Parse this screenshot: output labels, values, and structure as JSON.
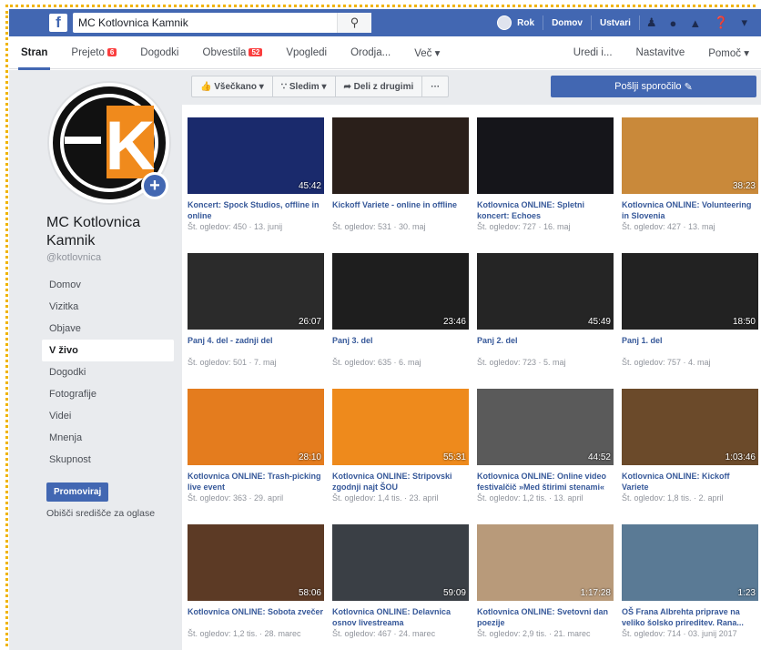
{
  "topbar": {
    "search_value": "MC Kotlovnica Kamnik",
    "user": "Rok",
    "home": "Domov",
    "create": "Ustvari",
    "brand_color": "#4267b2"
  },
  "subnav": {
    "tabs": [
      {
        "label": "Stran",
        "badge": ""
      },
      {
        "label": "Prejeto",
        "badge": "6"
      },
      {
        "label": "Dogodki",
        "badge": ""
      },
      {
        "label": "Obvestila",
        "badge": "52"
      },
      {
        "label": "Vpogledi",
        "badge": ""
      },
      {
        "label": "Orodja...",
        "badge": ""
      },
      {
        "label": "Več ▾",
        "badge": ""
      }
    ],
    "right": [
      "Uredi i...",
      "Nastavitve",
      "Pomoč ▾"
    ]
  },
  "page": {
    "logo_letter": "K",
    "name": "MC Kotlovnica Kamnik",
    "handle": "@kotlovnica",
    "nav": [
      "Domov",
      "Vizitka",
      "Objave",
      "V živo",
      "Dogodki",
      "Fotografije",
      "Videi",
      "Mnenja",
      "Skupnost"
    ],
    "selected_nav": "V živo",
    "promote": "Promoviraj",
    "ads_center": "Obišči središče za oglase"
  },
  "toolbar": {
    "all": "Vše­čkano",
    "follow": "Sledim",
    "share": "Deli z drugimi",
    "more": "···",
    "send_message": "Pošlji sporočilo"
  },
  "videos": [
    {
      "title": "Koncert: Spock Studios, offline in online",
      "meta": "Št. ogledov: 450 · 13. junij",
      "duration": "45:42",
      "thumb": "#1a2a6c"
    },
    {
      "title": "Kickoff Variete - online in offline",
      "meta": "Št. ogledov: 531 · 30. maj",
      "duration": "",
      "thumb": "#2a1f1a"
    },
    {
      "title": "Kotlovnica ONLINE: Spletni koncert: Echoes",
      "meta": "Št. ogledov: 727 · 16. maj",
      "duration": "",
      "thumb": "#15151a"
    },
    {
      "title": "Kotlovnica ONLINE: Volunteering in Slovenia",
      "meta": "Št. ogledov: 427 · 13. maj",
      "duration": "38:23",
      "thumb": "#c9893a"
    },
    {
      "title": "Panj 4. del - zadnji del",
      "meta": "Št. ogledov: 501 · 7. maj",
      "duration": "26:07",
      "thumb": "#2b2b2b"
    },
    {
      "title": "Panj 3. del",
      "meta": "Št. ogledov: 635 · 6. maj",
      "duration": "23:46",
      "thumb": "#1e1e1e"
    },
    {
      "title": "Panj 2. del",
      "meta": "Št. ogledov: 723 · 5. maj",
      "duration": "45:49",
      "thumb": "#252525"
    },
    {
      "title": "Panj 1. del",
      "meta": "Št. ogledov: 757 · 4. maj",
      "duration": "18:50",
      "thumb": "#222222"
    },
    {
      "title": "Kotlovnica ONLINE: Trash-picking live event",
      "meta": "Št. ogledov: 363 · 29. april",
      "duration": "28:10",
      "thumb": "#e47c1e"
    },
    {
      "title": "Kotlovnica ONLINE: Stripovski zgodnji najt ŠOU",
      "meta": "Št. ogledov: 1,4 tis. · 23. april",
      "duration": "55:31",
      "thumb": "#ee8a1c"
    },
    {
      "title": "Kotlovnica ONLINE: Online video festivalčič »Med štirimi stenami«",
      "meta": "Št. ogledov: 1,2 tis. · 13. april",
      "duration": "44:52",
      "thumb": "#5a5a5a"
    },
    {
      "title": "Kotlovnica ONLINE: Kickoff Variete",
      "meta": "Št. ogledov: 1,8 tis. · 2. april",
      "duration": "1:03:46",
      "thumb": "#6b4a2a"
    },
    {
      "title": "Kotlovnica ONLINE: Sobota zvečer",
      "meta": "Št. ogledov: 1,2 tis. · 28. marec",
      "duration": "58:06",
      "thumb": "#5c3a25"
    },
    {
      "title": "Kotlovnica ONLINE: Delavnica osnov livestreama",
      "meta": "Št. ogledov: 467 · 24. marec",
      "duration": "59:09",
      "thumb": "#3a3f45"
    },
    {
      "title": "Kotlovnica ONLINE: Svetovni dan poezije",
      "meta": "Št. ogledov: 2,9 tis. · 21. marec",
      "duration": "1:17:28",
      "thumb": "#b89a7a"
    },
    {
      "title": "OŠ Frana Albrehta priprave na veliko šolsko prireditev. Rana...",
      "meta": "Št. ogledov: 714 · 03. junij 2017",
      "duration": "1:23",
      "thumb": "#5a7a95"
    }
  ]
}
